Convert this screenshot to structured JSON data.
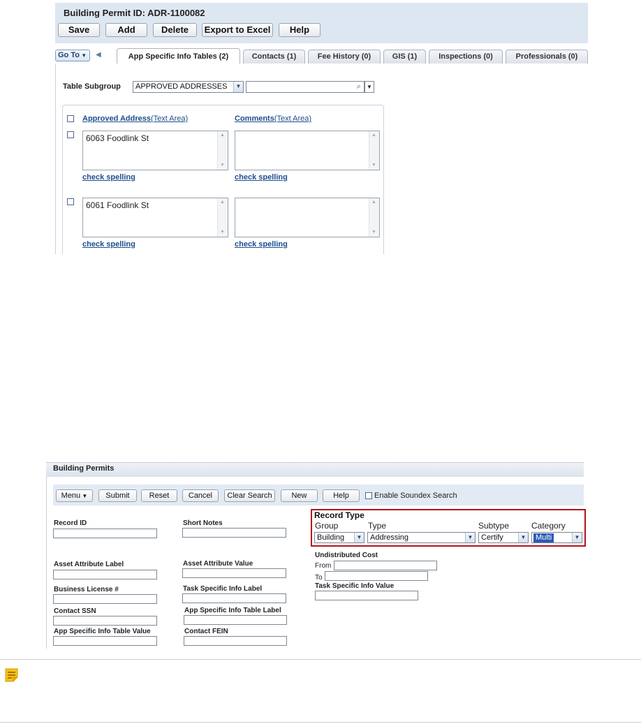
{
  "permit": {
    "title": "Building Permit ID: ADR-1100082",
    "toolbar": [
      "Save",
      "Add",
      "Delete",
      "Export to Excel",
      "Help"
    ],
    "goto_label": "Go To",
    "tabs": [
      {
        "label": "App Specific Info Tables (2)",
        "active": true
      },
      {
        "label": "Contacts (1)",
        "active": false
      },
      {
        "label": "Fee History (0)",
        "active": false
      },
      {
        "label": "GIS (1)",
        "active": false
      },
      {
        "label": "Inspections (0)",
        "active": false
      },
      {
        "label": "Professionals (0)",
        "active": false
      }
    ],
    "subgroup_label": "Table Subgroup",
    "subgroup_value": "APPROVED ADDRESSES",
    "search_value": "",
    "table": {
      "col1_link": "Approved Address",
      "col1_type": "(Text Area)",
      "col2_link": "Comments",
      "col2_type": "(Text Area)",
      "rows": [
        {
          "address": "6063 Foodlink St",
          "comment": ""
        },
        {
          "address": "6061 Foodlink St",
          "comment": ""
        }
      ],
      "spell_label": "check spelling"
    }
  },
  "search": {
    "title": "Building Permits",
    "buttons": {
      "menu": "Menu",
      "submit": "Submit",
      "reset": "Reset",
      "cancel": "Cancel",
      "clear": "Clear Search",
      "new": "New",
      "help": "Help"
    },
    "soundex_label": "Enable Soundex Search",
    "fields": {
      "record_id": "Record ID",
      "short_notes": "Short Notes",
      "asset_attr_label": "Asset Attribute Label",
      "asset_attr_value": "Asset Attribute Value",
      "business_license": "Business License #",
      "task_info_label": "Task Specific Info Label",
      "contact_ssn": "Contact SSN",
      "app_table_label": "App Specific Info Table Label",
      "app_table_value": "App Specific Info Table Value",
      "contact_fein": "Contact FEIN",
      "undistributed_cost": "Undistributed Cost",
      "from": "From",
      "to": "To",
      "task_info_value": "Task Specific Info Value"
    },
    "record_type": {
      "heading": "Record Type",
      "group_label": "Group",
      "type_label": "Type",
      "subtype_label": "Subtype",
      "category_label": "Category",
      "group_value": "Building",
      "type_value": "Addressing",
      "subtype_value": "Certify",
      "category_value": "Multi"
    }
  },
  "icons": {
    "note": "note-icon",
    "search": "magnifier-icon"
  }
}
